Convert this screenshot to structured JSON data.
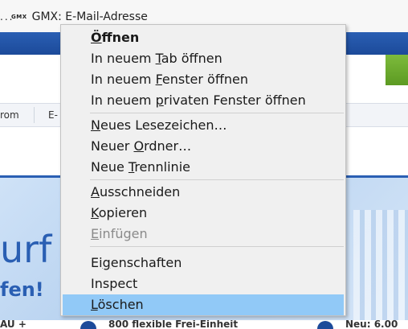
{
  "bookmarks": {
    "overflow": "...",
    "gmx_logo": "GMX",
    "gmx_label": "GMX: E-Mail-Adresse"
  },
  "nav": {
    "tab_1": "rom",
    "tab_2": "E-"
  },
  "promo": {
    "headline": "urf F",
    "subline": "fen!"
  },
  "bottom": {
    "text_1": "AU + ",
    "text_2": "800 flexible Frei-Einheit",
    "text_3": "Neu: 6.00"
  },
  "context_menu": {
    "items": [
      {
        "label": "Öffnen",
        "accel_pre": "",
        "accel": "Ö",
        "accel_post": "ffnen"
      },
      {
        "label": "In neuem Tab öffnen",
        "accel_pre": "In neuem ",
        "accel": "T",
        "accel_post": "ab öffnen"
      },
      {
        "label": "In neuem Fenster öffnen",
        "accel_pre": "In neuem ",
        "accel": "F",
        "accel_post": "enster öffnen"
      },
      {
        "label": "In neuem privaten Fenster öffnen",
        "accel_pre": "In neuem ",
        "accel": "p",
        "accel_post": "rivaten Fenster öffnen"
      },
      {
        "label": "Neues Lesezeichen…",
        "accel_pre": "",
        "accel": "N",
        "accel_post": "eues Lesezeichen…"
      },
      {
        "label": "Neuer Ordner…",
        "accel_pre": "Neuer ",
        "accel": "O",
        "accel_post": "rdner…"
      },
      {
        "label": "Neue Trennlinie",
        "accel_pre": "Neue ",
        "accel": "T",
        "accel_post": "rennlinie"
      },
      {
        "label": "Ausschneiden",
        "accel_pre": "",
        "accel": "A",
        "accel_post": "usschneiden"
      },
      {
        "label": "Kopieren",
        "accel_pre": "",
        "accel": "K",
        "accel_post": "opieren"
      },
      {
        "label": "Einfügen",
        "accel_pre": "",
        "accel": "E",
        "accel_post": "infügen"
      },
      {
        "label": "Eigenschaften",
        "accel_pre": "Ei",
        "accel": "g",
        "accel_post": "enschaften"
      },
      {
        "label": "Inspect",
        "accel_pre": "Inspect",
        "accel": "",
        "accel_post": ""
      },
      {
        "label": "Löschen",
        "accel_pre": "",
        "accel": "L",
        "accel_post": "öschen"
      }
    ],
    "disabled_item": "Einfügen",
    "selected_item": "Löschen"
  },
  "colors": {
    "menu_bg": "#f0f0f0",
    "selection": "#91c9f7",
    "header_blue": "#2a5fb3",
    "accent_green": "#7dbb3c"
  }
}
